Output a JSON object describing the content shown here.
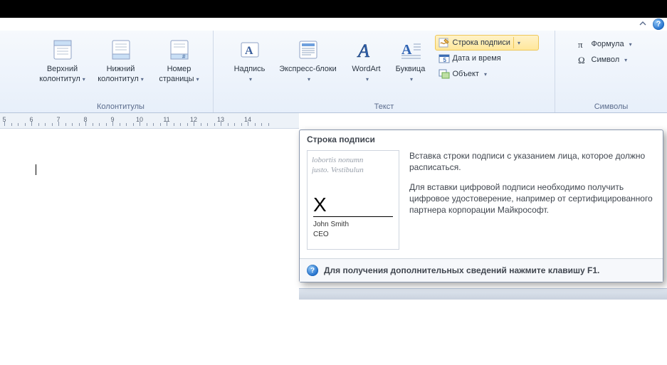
{
  "ribbon": {
    "groups": {
      "headers_footers": {
        "label": "Колонтитулы",
        "header": "Верхний\nколонтитул",
        "footer": "Нижний\nколонтитул",
        "page_number": "Номер\nстраницы"
      },
      "text": {
        "label": "Текст",
        "textbox": "Надпись",
        "quickparts": "Экспресс-блоки",
        "wordart": "WordArt",
        "dropcap": "Буквица",
        "signature_line": "Строка подписи",
        "date_time": "Дата и время",
        "object": "Объект"
      },
      "symbols": {
        "label": "Символы",
        "equation": "Формула",
        "symbol": "Символ"
      }
    }
  },
  "ruler": {
    "numbers": [
      "5",
      "6",
      "7",
      "8",
      "9",
      "10",
      "11",
      "12",
      "13",
      "14"
    ]
  },
  "tooltip": {
    "title": "Строка подписи",
    "thumb_faded_line1": "lobortis nonumn",
    "thumb_faded_line2": "justo. Vestibulun",
    "thumb_x": "X",
    "thumb_name": "John Smith",
    "thumb_role": "CEO",
    "para1": "Вставка строки подписи с указанием лица, которое должно расписаться.",
    "para2": "Для вставки цифровой подписи необходимо получить цифровое удостоверение, например от сертифицированного партнера корпорации Майкрософт.",
    "footer": "Для получения дополнительных сведений нажмите клавишу F1."
  }
}
